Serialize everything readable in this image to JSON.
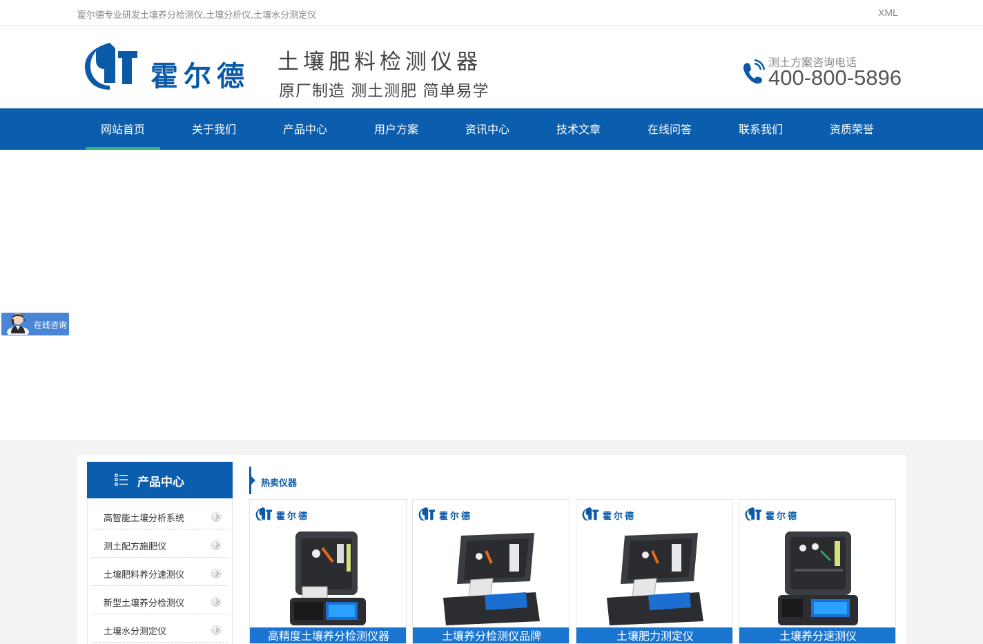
{
  "topbar": {
    "slogan": "霍尔德专业研发土壤养分检测仪,土壤分析仪,土壤水分测定仪",
    "xml": "XML"
  },
  "header": {
    "logo_text": "霍尔德",
    "title": "土壤肥料检测仪器",
    "subtitle": "原厂制造 测土测肥 简单易学",
    "phone_label": "测土方案咨询电话",
    "phone_number": "400-800-5896"
  },
  "nav": {
    "items": [
      {
        "label": "网站首页",
        "active": true
      },
      {
        "label": "关于我们"
      },
      {
        "label": "产品中心"
      },
      {
        "label": "用户方案"
      },
      {
        "label": "资讯中心"
      },
      {
        "label": "技术文章"
      },
      {
        "label": "在线问答"
      },
      {
        "label": "联系我们"
      },
      {
        "label": "资质荣誉"
      }
    ]
  },
  "consult": {
    "label": "在线咨询"
  },
  "sidebar": {
    "title": "产品中心",
    "items": [
      {
        "label": "高智能土壤分析系统"
      },
      {
        "label": "测土配方施肥仪"
      },
      {
        "label": "土壤肥料养分速测仪"
      },
      {
        "label": "新型土壤养分检测仪"
      },
      {
        "label": "土壤水分测定仪"
      }
    ]
  },
  "hot": {
    "title": "热卖仪器",
    "brand": "霍尔德",
    "products": [
      {
        "caption": "高精度土壤养分检测仪器"
      },
      {
        "caption": "土壤养分检测仪品牌"
      },
      {
        "caption": "土壤肥力测定仪"
      },
      {
        "caption": "土壤养分速测仪"
      }
    ]
  },
  "colors": {
    "brand_blue": "#0b5dad",
    "nav_active_underline": "#2bb673",
    "caption_blue": "#1a75d1"
  }
}
